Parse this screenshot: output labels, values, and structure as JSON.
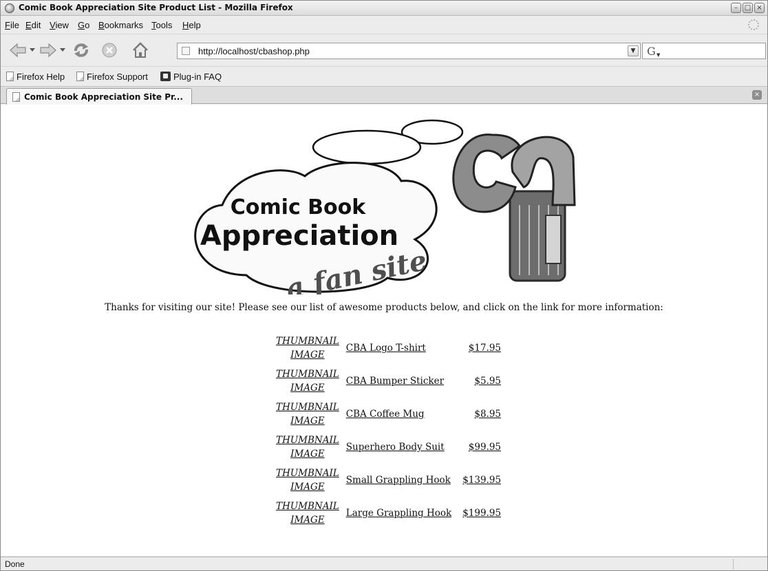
{
  "window": {
    "title": "Comic Book Appreciation Site Product List - Mozilla Firefox",
    "controls": [
      "minimize",
      "maximize",
      "close"
    ]
  },
  "menu": {
    "items": [
      {
        "label": "File",
        "access": "F",
        "rest": "ile"
      },
      {
        "label": "Edit",
        "access": "E",
        "rest": "dit"
      },
      {
        "label": "View",
        "access": "V",
        "rest": "iew"
      },
      {
        "label": "Go",
        "access": "G",
        "rest": "o"
      },
      {
        "label": "Bookmarks",
        "access": "B",
        "rest": "ookmarks"
      },
      {
        "label": "Tools",
        "access": "T",
        "rest": "ools"
      },
      {
        "label": "Help",
        "access": "H",
        "rest": "elp"
      }
    ]
  },
  "navigation": {
    "icons": [
      "back-icon",
      "dropdown-icon",
      "forward-icon",
      "dropdown-icon",
      "reload-icon",
      "stop-icon",
      "home-icon"
    ],
    "url": "http://localhost/cbashop.php",
    "search_engine_icon": "G"
  },
  "bookmarks": {
    "items": [
      {
        "label": "Firefox Help",
        "icon": "page-icon"
      },
      {
        "label": "Firefox Support",
        "icon": "page-icon"
      },
      {
        "label": "Plug-in FAQ",
        "icon": "plugin-icon"
      }
    ]
  },
  "tabs": [
    {
      "label": "Comic Book Appreciation Site Pr...",
      "active": true
    }
  ],
  "page": {
    "logo": {
      "line1": "Comic Book",
      "line2": "Appreciation",
      "tagline": "a fan site",
      "monogram": "CBA"
    },
    "intro": "Thanks for visiting our site! Please see our list of awesome products below, and click on the link for more information:",
    "thumbnail_line1": "THUMBNAIL",
    "thumbnail_line2": "IMAGE",
    "products": [
      {
        "name": "CBA Logo T-shirt",
        "price": "$17.95"
      },
      {
        "name": "CBA Bumper Sticker",
        "price": "$5.95"
      },
      {
        "name": "CBA Coffee Mug",
        "price": "$8.95"
      },
      {
        "name": "Superhero Body Suit",
        "price": "$99.95"
      },
      {
        "name": "Small Grappling Hook",
        "price": "$139.95"
      },
      {
        "name": "Large Grappling Hook",
        "price": "$199.95"
      }
    ]
  },
  "status": {
    "text": "Done"
  }
}
